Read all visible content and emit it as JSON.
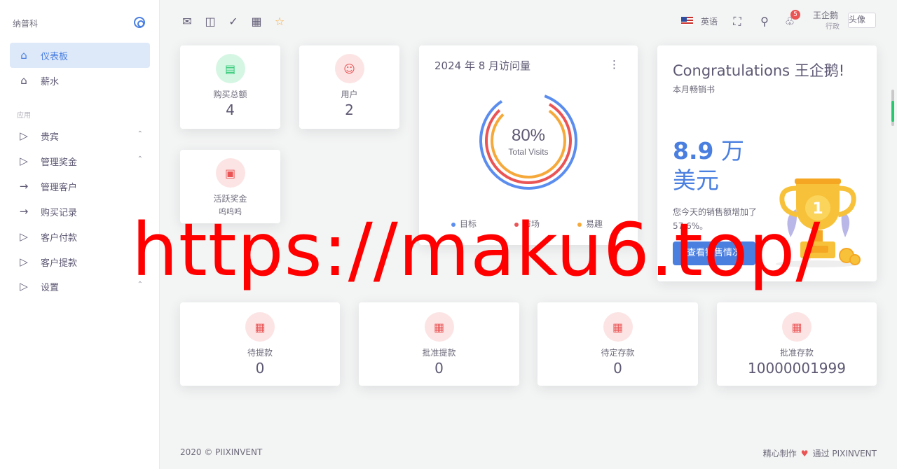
{
  "sidebar": {
    "brand": "纳普科",
    "section_label": "应用",
    "items": [
      {
        "label": "仪表板",
        "icon": "home-icon"
      },
      {
        "label": "薪水",
        "icon": "home-icon"
      },
      {
        "label": "贵宾",
        "icon": "play-icon"
      },
      {
        "label": "管理奖金",
        "icon": "play-icon"
      },
      {
        "label": "管理客户",
        "icon": "arrow-right-icon"
      },
      {
        "label": "购买记录",
        "icon": "arrow-right-icon"
      },
      {
        "label": "客户付款",
        "icon": "play-icon"
      },
      {
        "label": "客户提款",
        "icon": "play-icon"
      },
      {
        "label": "设置",
        "icon": "play-icon"
      }
    ]
  },
  "topbar": {
    "language": "英语",
    "notification_count": "5",
    "user_name": "王企鹅",
    "user_role": "行政",
    "avatar_alt": "头像"
  },
  "stats": {
    "purchase_total": {
      "label": "购买总额",
      "value": "4"
    },
    "users": {
      "label": "用户",
      "value": "2"
    },
    "active_bonus": {
      "label": "活跃奖金",
      "value": "呜呜呜"
    }
  },
  "visits": {
    "title": "2024 年 8 月访问量",
    "percent": "80%",
    "caption": "Total Visits",
    "legend": [
      {
        "label": "目标",
        "color": "#5b8def"
      },
      {
        "label": "市场",
        "color": "#ea5455"
      },
      {
        "label": "易趣",
        "color": "#f6a93b"
      }
    ]
  },
  "congrats": {
    "title": "Congratulations 王企鹅!",
    "subtitle": "本月畅销书",
    "amount_number": "8.9",
    "amount_unit": "万",
    "currency": "美元",
    "desc": "您今天的销售额增加了 57.6%。",
    "button": "查看销售情况"
  },
  "bottom_stats": [
    {
      "label": "待提款",
      "value": "0"
    },
    {
      "label": "批准提款",
      "value": "0"
    },
    {
      "label": "待定存款",
      "value": "0"
    },
    {
      "label": "批准存款",
      "value": "10000001999"
    }
  ],
  "footer": {
    "copyright": "2020 © PIIXINVENT",
    "credit_prefix": "精心制作",
    "credit_suffix": "通过 PIXINVENT"
  },
  "watermark": "https://maku6.top/"
}
